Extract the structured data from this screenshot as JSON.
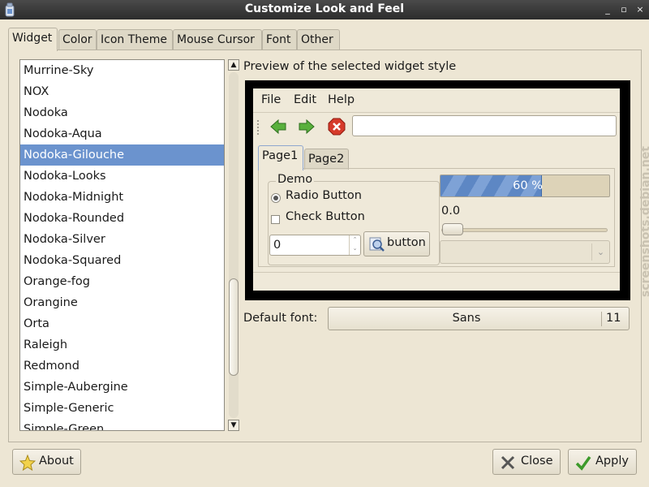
{
  "window": {
    "title": "Customize Look and Feel",
    "controls": [
      "_",
      "▫",
      "×"
    ]
  },
  "tabs": [
    {
      "label": "Widget",
      "active": true
    },
    {
      "label": "Color"
    },
    {
      "label": "Icon Theme"
    },
    {
      "label": "Mouse Cursor"
    },
    {
      "label": "Font"
    },
    {
      "label": "Other"
    }
  ],
  "theme_list": {
    "items": [
      "Murrine-Sky",
      "NOX",
      "Nodoka",
      "Nodoka-Aqua",
      "Nodoka-Gilouche",
      "Nodoka-Looks",
      "Nodoka-Midnight",
      "Nodoka-Rounded",
      "Nodoka-Silver",
      "Nodoka-Squared",
      "Orange-fog",
      "Orangine",
      "Orta",
      "Raleigh",
      "Redmond",
      "Simple-Aubergine",
      "Simple-Generic",
      "Simple-Green"
    ],
    "selected": "Nodoka-Gilouche",
    "scroll_arrows": {
      "up": "▲",
      "down": "▼"
    }
  },
  "preview": {
    "label": "Preview of the selected widget style",
    "menu": [
      "File",
      "Edit",
      "Help"
    ],
    "toolbar_icons": [
      "back-arrow-icon",
      "forward-arrow-icon",
      "stop-icon"
    ],
    "entry_value": "",
    "tabs": [
      "Page1",
      "Page2"
    ],
    "demo_frame_label": "Demo",
    "radio_label": "Radio Button",
    "check_label": "Check Button",
    "spin_value": "0",
    "spin_arrows": "⌃\n⌄",
    "button_label": "button",
    "progress_text": "60 %",
    "progress_fraction": 0.6,
    "scale_value": "0.0",
    "combo_value": "",
    "combo_arrow": "⌄"
  },
  "font": {
    "label": "Default font:",
    "name": "Sans",
    "size": "11"
  },
  "watermark": "screenshots.debian.net",
  "buttons": {
    "about": "About",
    "close": "Close",
    "apply": "Apply"
  },
  "colors": {
    "selection": "#6b93ce",
    "background": "#ede6d4",
    "progress": "#5d87c4"
  }
}
